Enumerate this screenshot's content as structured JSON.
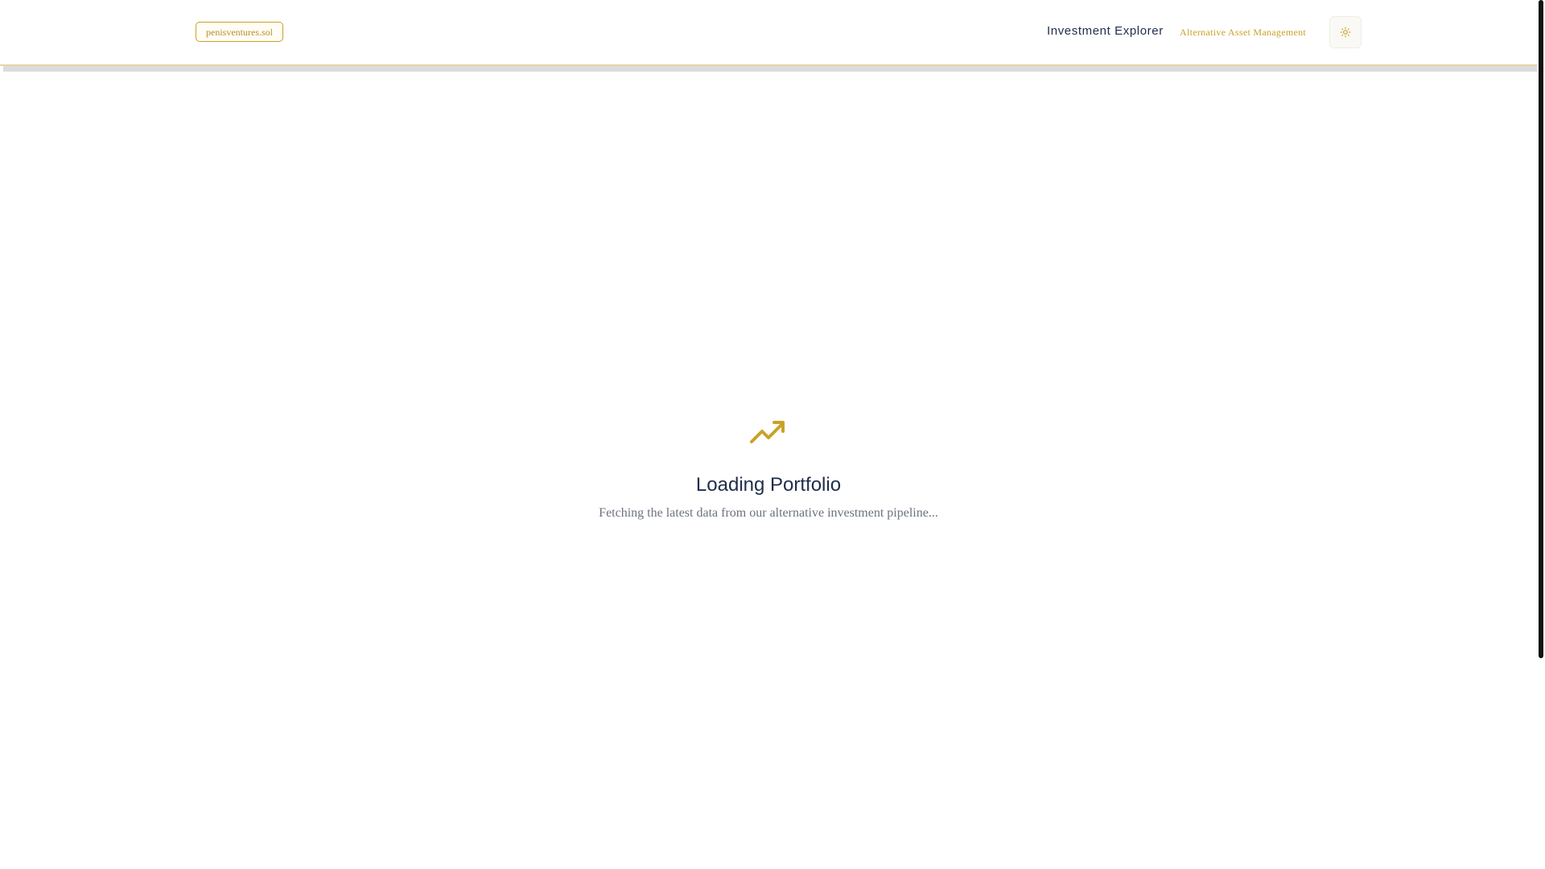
{
  "header": {
    "domain_badge": "penisventures.sol",
    "title": "Investment Explorer",
    "subtitle": "Alternative Asset Management",
    "theme_toggle_icon": "sun-icon"
  },
  "main": {
    "loading_icon": "trending-up-icon",
    "loading_title": "Loading Portfolio",
    "loading_message": "Fetching the latest data from our alternative investment pipeline..."
  },
  "colors": {
    "accent": "#c9a227",
    "heading": "#1f2d4a",
    "muted_text": "#6b7280",
    "header_border": "#e3d6a6"
  }
}
